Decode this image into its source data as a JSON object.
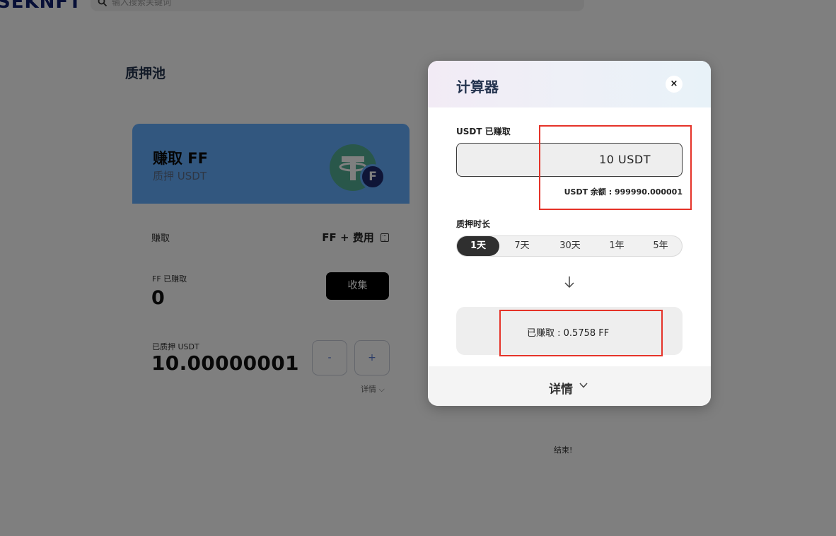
{
  "header": {
    "logo_text": "SEKNFT",
    "search_placeholder": "输入搜索关键词"
  },
  "pool": {
    "title": "质押池",
    "card": {
      "title": "赚取 FF",
      "subtitle": "质押 USDT",
      "earn_label": "赚取",
      "earn_value": "FF + 费用",
      "ff_earned_label": "FF 已赚取",
      "ff_earned_value": "0",
      "collect_label": "收集",
      "staked_label": "已质押 USDT",
      "staked_value": "10.00000001",
      "minus_label": "-",
      "plus_label": "+",
      "details_link": "详情 ⌵"
    },
    "end_text": "结束!"
  },
  "calculator": {
    "title": "计算器",
    "close_label": "×",
    "usdt_earned_label": "USDT 已赚取",
    "amount_value": "10  USDT",
    "balance_text": "USDT 余额 : 999990.000001",
    "duration_label": "质押时长",
    "durations": [
      {
        "label": "1天",
        "active": true
      },
      {
        "label": "7天",
        "active": false
      },
      {
        "label": "30天",
        "active": false
      },
      {
        "label": "1年",
        "active": false
      },
      {
        "label": "5年",
        "active": false
      }
    ],
    "result_text": "已赚取 : 0.5758 FF",
    "details_label": "详情"
  },
  "colors": {
    "card_header": "#65aefe",
    "overlay": "rgba(0,0,0,0.5)",
    "highlight": "#e53329",
    "tether_green": "#53ae94"
  }
}
